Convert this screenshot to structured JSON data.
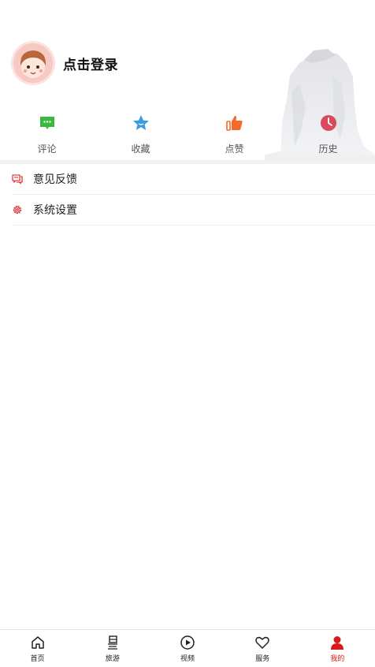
{
  "profile": {
    "login_label": "点击登录"
  },
  "quick_actions": [
    {
      "label": "评论",
      "icon": "comment-icon",
      "color": "#3cb83c"
    },
    {
      "label": "收藏",
      "icon": "star-icon",
      "color": "#3a9be0"
    },
    {
      "label": "点赞",
      "icon": "thumbs-up-icon",
      "color": "#f36b2a"
    },
    {
      "label": "历史",
      "icon": "clock-icon",
      "color": "#d94b5c"
    }
  ],
  "menu": [
    {
      "label": "意见反馈",
      "icon": "feedback-icon"
    },
    {
      "label": "系统设置",
      "icon": "gear-icon"
    }
  ],
  "tabbar": {
    "accent": "#d71a1b",
    "items": [
      {
        "label": "首页",
        "icon": "home-icon"
      },
      {
        "label": "旅游",
        "icon": "travel-icon"
      },
      {
        "label": "视频",
        "icon": "play-icon"
      },
      {
        "label": "服务",
        "icon": "heart-icon"
      },
      {
        "label": "我的",
        "icon": "user-icon",
        "active": true
      }
    ]
  }
}
